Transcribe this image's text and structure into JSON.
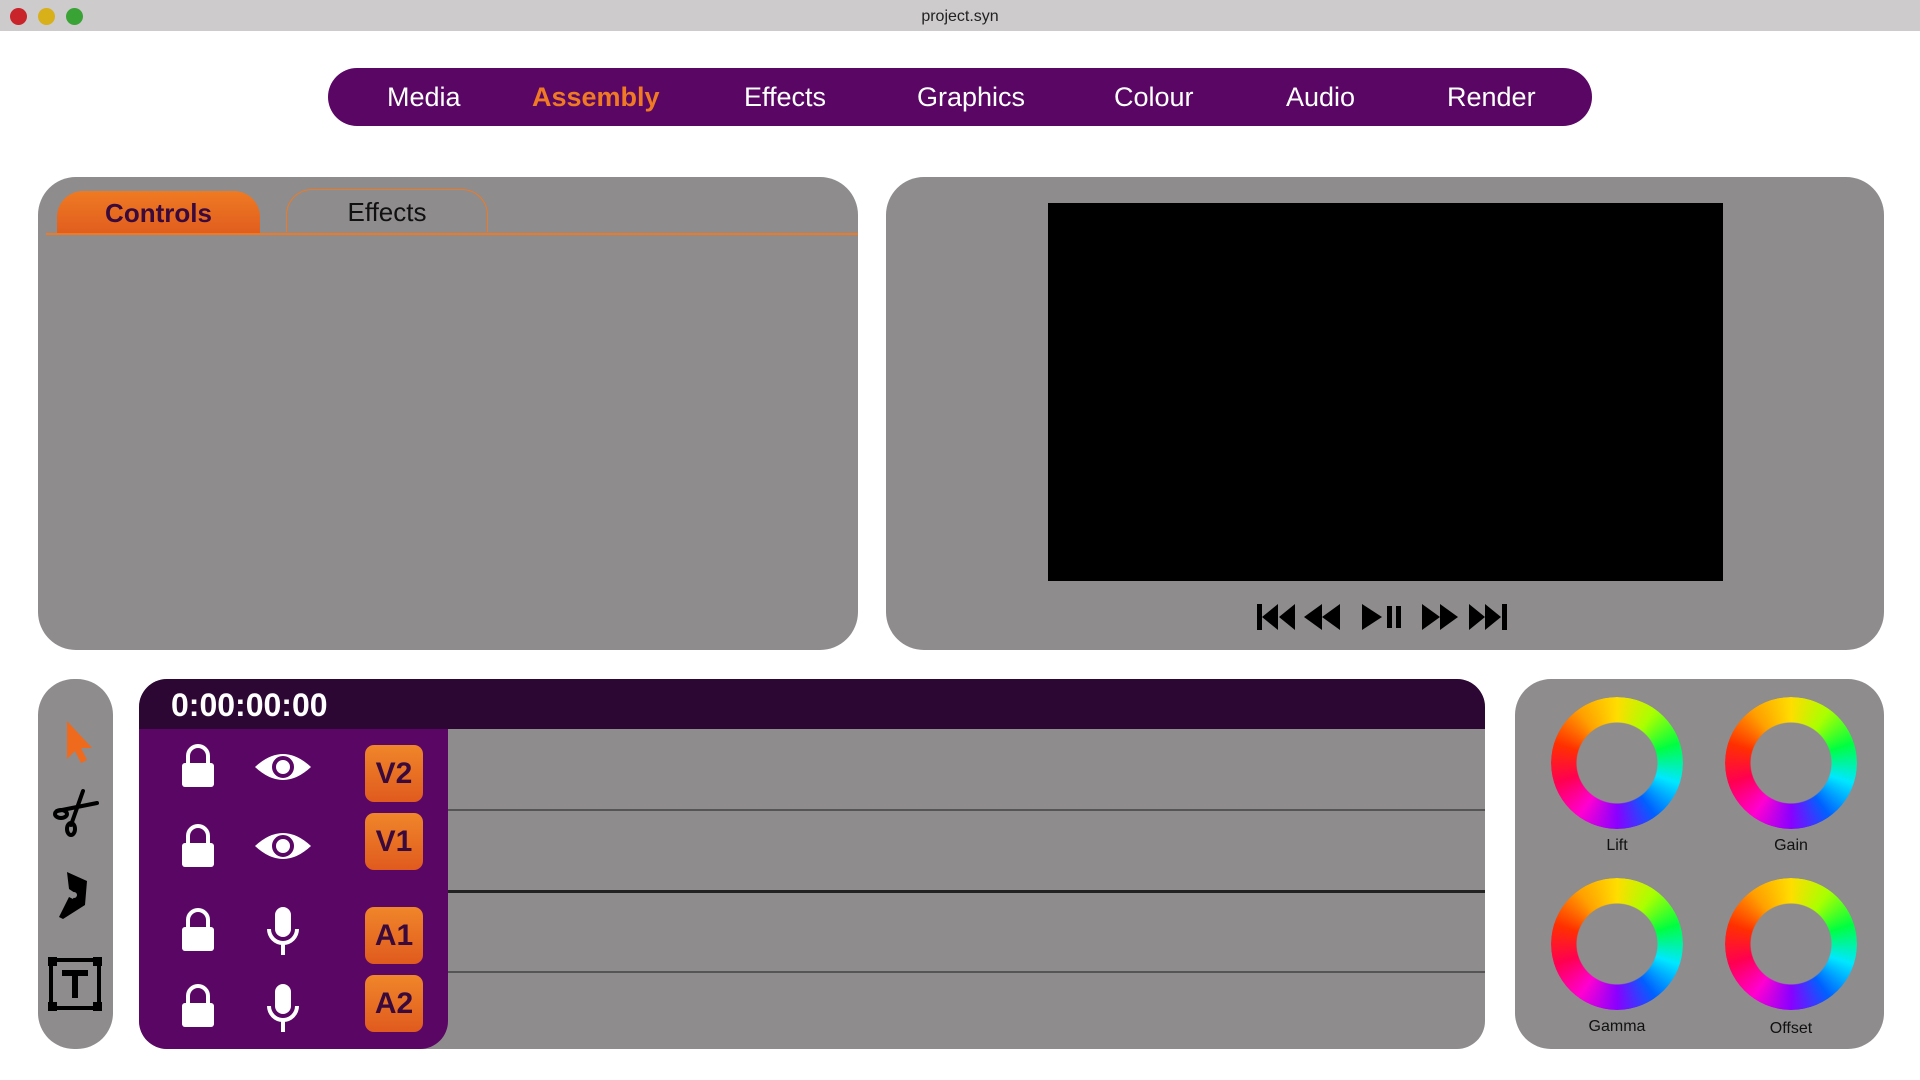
{
  "window": {
    "title": "project.syn"
  },
  "nav": {
    "items": [
      {
        "label": "Media"
      },
      {
        "label": "Assembly",
        "active": true
      },
      {
        "label": "Effects"
      },
      {
        "label": "Graphics"
      },
      {
        "label": "Colour"
      },
      {
        "label": "Audio"
      },
      {
        "label": "Render"
      }
    ]
  },
  "controls_panel": {
    "tabs": [
      {
        "label": "Controls",
        "active": true
      },
      {
        "label": "Effects"
      }
    ]
  },
  "viewer": {
    "transport": [
      "skip-to-start-icon",
      "rewind-icon",
      "play-pause-icon",
      "fast-forward-icon",
      "skip-to-end-icon"
    ]
  },
  "tools": [
    "selection-arrow-icon",
    "razor-scissors-icon",
    "pen-icon",
    "text-icon"
  ],
  "timeline": {
    "timecode": "0:00:00:00",
    "tracks": [
      {
        "label": "V2",
        "type": "video"
      },
      {
        "label": "V1",
        "type": "video"
      },
      {
        "label": "A1",
        "type": "audio"
      },
      {
        "label": "A2",
        "type": "audio"
      }
    ]
  },
  "color_wheels": {
    "lift": "Lift",
    "gain": "Gain",
    "gamma": "Gamma",
    "offset": "Offset"
  },
  "colors": {
    "nav_bg": "#5a0664",
    "accent": "#ef7a23",
    "panel_bg": "#8e8c8d",
    "timeline_header_bg": "#2c0733"
  }
}
